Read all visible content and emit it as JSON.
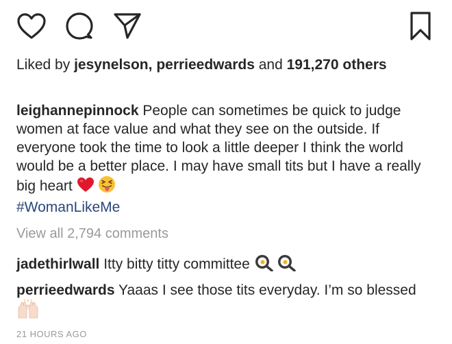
{
  "actions": {
    "icons": [
      "heart-icon",
      "comment-icon",
      "share-icon",
      "bookmark-icon"
    ]
  },
  "likes": {
    "prefix": "Liked by",
    "user1": "jesynelson",
    "separator": ",",
    "user2": "perrieedwards",
    "and": "and",
    "count": "191,270",
    "suffix": "others"
  },
  "caption": {
    "username": "leighannepinnock",
    "text": "People can sometimes be quick to judge women at face value and what they see on the outside. If everyone took the time to look a little deeper I think the world would be a better place. I may have small tits but I have a really big heart",
    "emojis": [
      "red-heart-emoji",
      "squinting-tongue-emoji"
    ],
    "hashtag": "#WomanLikeMe"
  },
  "view_all": "View all 2,794 comments",
  "comments": [
    {
      "username": "jadethirlwall",
      "text": "Itty bitty titty committee",
      "emojis": [
        "fried-egg-emoji",
        "fried-egg-emoji"
      ]
    },
    {
      "username": "perrieedwards",
      "text": "Yaaas I see those tits everyday. I’m so blessed",
      "emojis": [
        "raising-hands-emoji"
      ]
    }
  ],
  "timestamp": "21 HOURS AGO",
  "colors": {
    "text": "#262626",
    "muted": "#9a9a9a",
    "hashtag": "#27477a",
    "heart": "#e0182d"
  }
}
